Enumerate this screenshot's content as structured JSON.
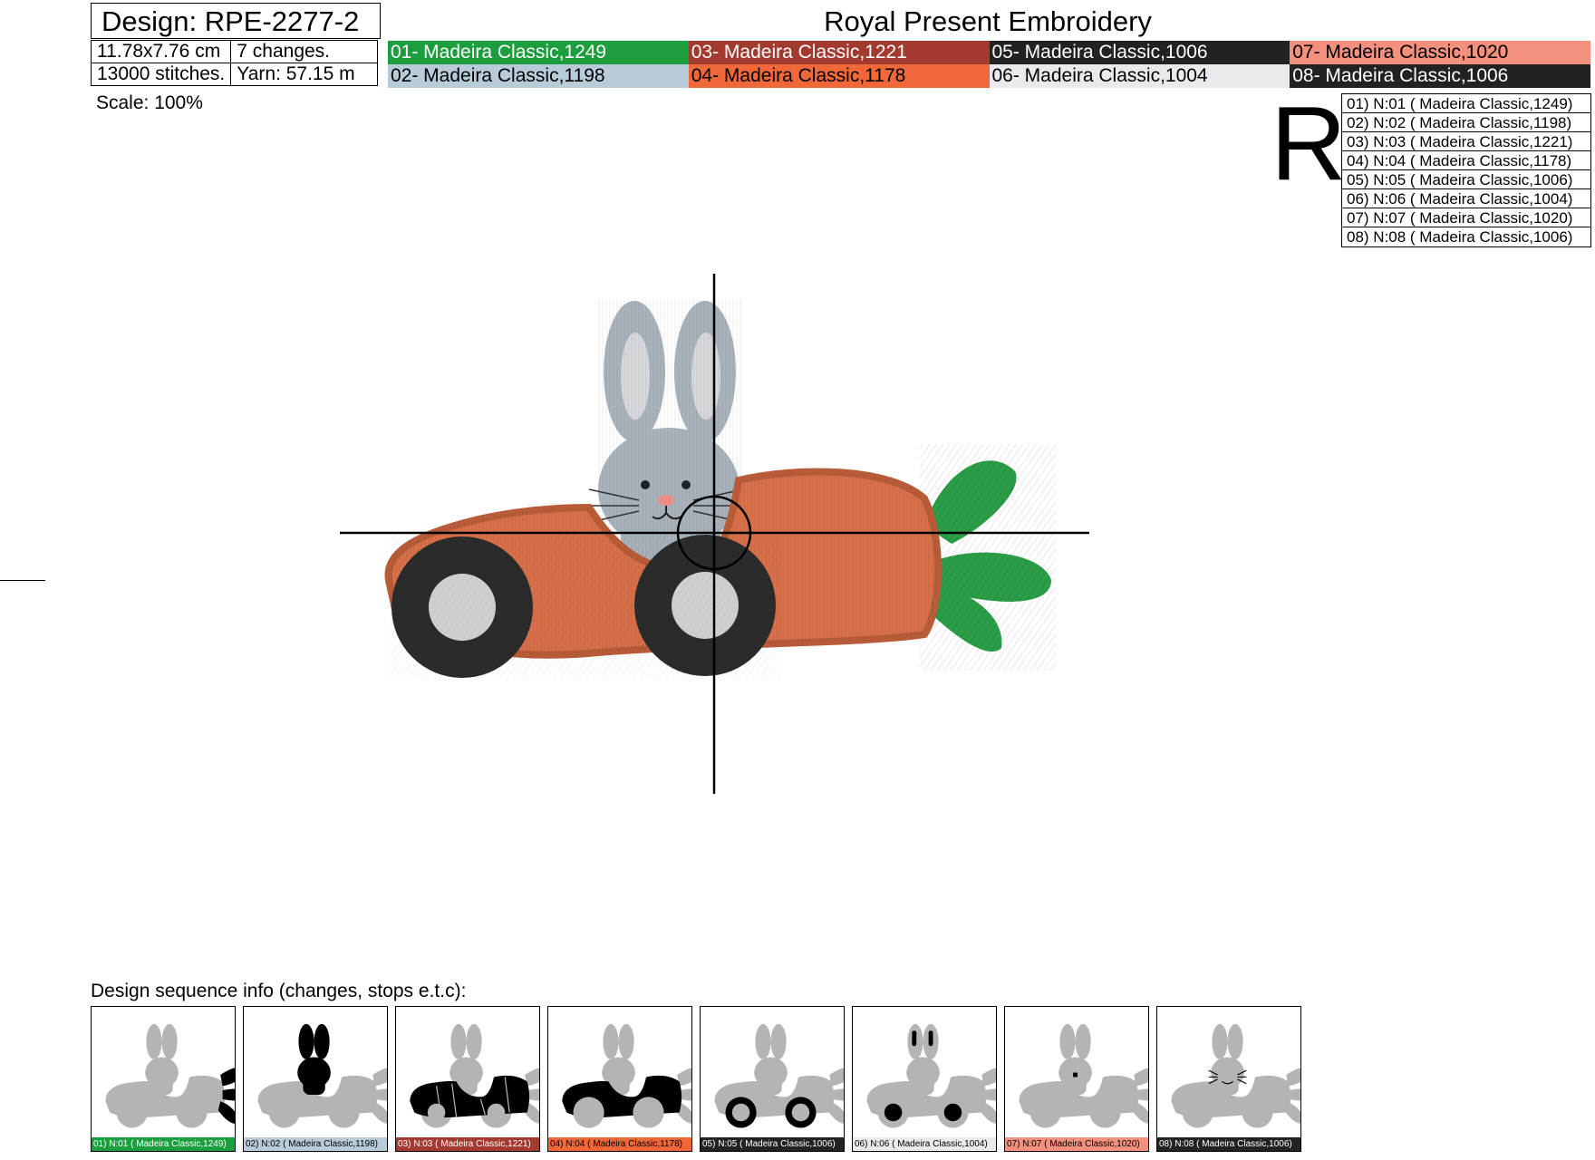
{
  "header": {
    "design_label": "Design: RPE-2277-2",
    "brand": "Royal Present Embroidery",
    "size": "11.78x7.76 cm",
    "changes": "7 changes.",
    "stitches": "13000 stitches.",
    "yarn": "Yarn: 57.15 m",
    "scale": "Scale: 100%"
  },
  "threads": [
    {
      "label": "01- Madeira Classic,1249",
      "bg": "#1d9e3e",
      "fg": "#ffffff"
    },
    {
      "label": "02- Madeira Classic,1198",
      "bg": "#b8cbd9",
      "fg": "#000000"
    },
    {
      "label": "03- Madeira Classic,1221",
      "bg": "#a33a30",
      "fg": "#ffffff"
    },
    {
      "label": "04- Madeira Classic,1178",
      "bg": "#f0683a",
      "fg": "#000000"
    },
    {
      "label": "05- Madeira Classic,1006",
      "bg": "#222222",
      "fg": "#ffffff"
    },
    {
      "label": "06- Madeira Classic,1004",
      "bg": "#e9e9ee",
      "fg": "#000000"
    },
    {
      "label": "07- Madeira Classic,1020",
      "bg": "#f4907e",
      "fg": "#000000"
    },
    {
      "label": "08- Madeira Classic,1006",
      "bg": "#222222",
      "fg": "#ffffff"
    }
  ],
  "logo": "R",
  "needles": [
    "01) N:01 ( Madeira Classic,1249)",
    "02) N:02 ( Madeira Classic,1198)",
    "03) N:03 ( Madeira Classic,1221)",
    "04) N:04 ( Madeira Classic,1178)",
    "05) N:05 ( Madeira Classic,1006)",
    "06) N:06 ( Madeira Classic,1004)",
    "07) N:07 ( Madeira Classic,1020)",
    "08) N:08 ( Madeira Classic,1006)"
  ],
  "colors": {
    "carrot": "#d8714a",
    "carrot_dark": "#b85b38",
    "leaf": "#2a9d46",
    "bunny": "#a9b3bb",
    "ear_inner": "#d7d9dc",
    "wheel": "#2b2b2b",
    "hub": "#cfcfcf",
    "nose": "#f08c86",
    "silhouette": "#b4b4b4"
  },
  "sequence": {
    "title": "Design sequence info (changes, stops e.t.c):",
    "steps": [
      {
        "label": "01) N:01 ( Madeira Classic,1249)",
        "highlight": "leaves"
      },
      {
        "label": "02) N:02 ( Madeira Classic,1198)",
        "highlight": "bunny"
      },
      {
        "label": "03) N:03 ( Madeira Classic,1221)",
        "highlight": "car-striped"
      },
      {
        "label": "04) N:04 ( Madeira Classic,1178)",
        "highlight": "car-body"
      },
      {
        "label": "05) N:05 ( Madeira Classic,1006)",
        "highlight": "tires"
      },
      {
        "label": "06) N:06 ( Madeira Classic,1004)",
        "highlight": "hubs-ears"
      },
      {
        "label": "07) N:07 ( Madeira Classic,1020)",
        "highlight": "nose"
      },
      {
        "label": "08) N:08 ( Madeira Classic,1006)",
        "highlight": "whiskers"
      }
    ]
  }
}
